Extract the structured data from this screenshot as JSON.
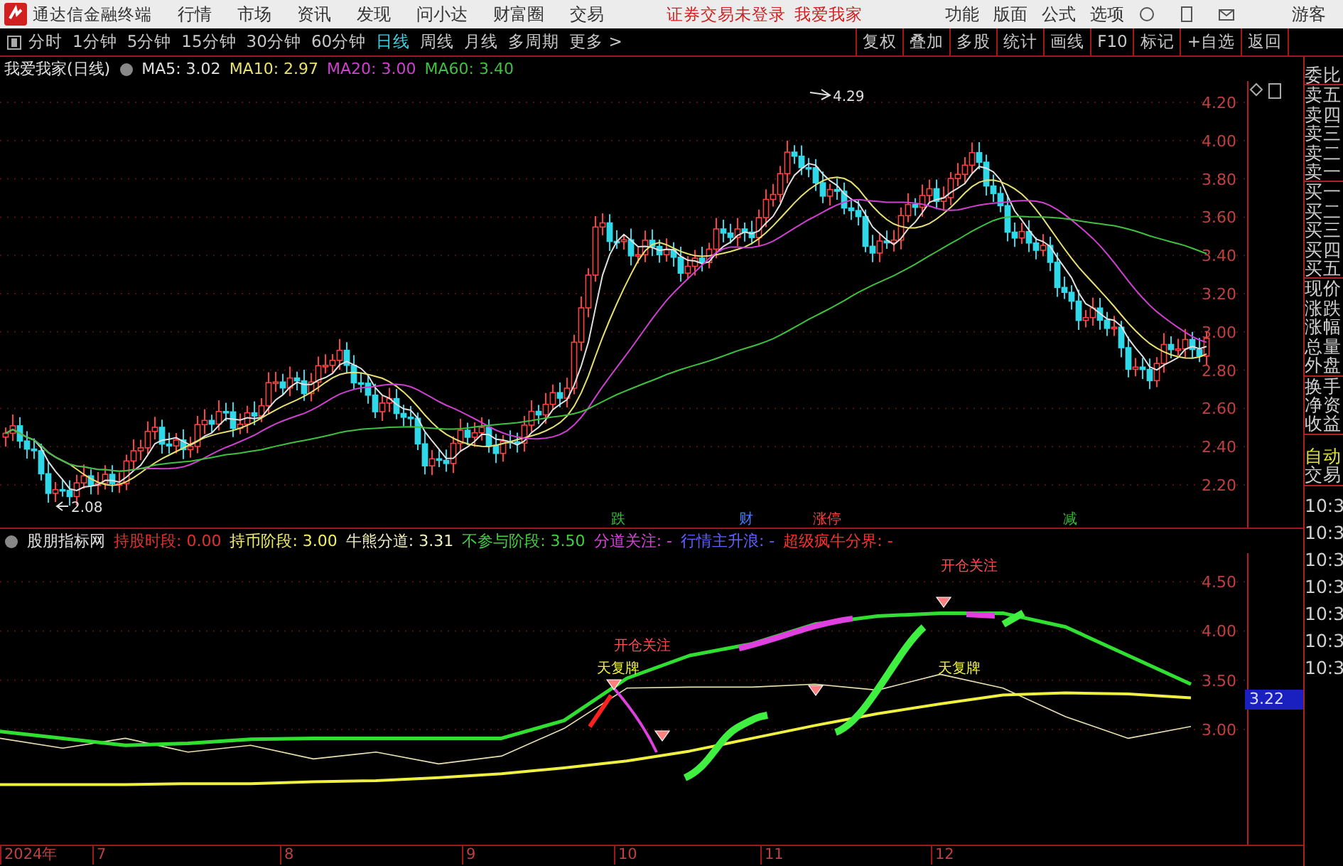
{
  "title_bar": {
    "app_name": "通达信金融终端",
    "menus": [
      "行情",
      "市场",
      "资讯",
      "发现",
      "问小达",
      "财富圈",
      "交易"
    ],
    "login_status": "证券交易未登录",
    "user_link": "我爱我家",
    "right_menus": [
      "功能",
      "版面",
      "公式",
      "选项"
    ],
    "user": "游客"
  },
  "toolbar": {
    "periods": [
      {
        "label": "分时",
        "selected": false
      },
      {
        "label": "1分钟",
        "selected": false
      },
      {
        "label": "5分钟",
        "selected": false
      },
      {
        "label": "15分钟",
        "selected": false
      },
      {
        "label": "30分钟",
        "selected": false
      },
      {
        "label": "60分钟",
        "selected": false
      },
      {
        "label": "日线",
        "selected": true
      },
      {
        "label": "周线",
        "selected": false
      },
      {
        "label": "月线",
        "selected": false
      },
      {
        "label": "多周期",
        "selected": false
      },
      {
        "label": "更多 >",
        "selected": false
      }
    ],
    "buttons": [
      "复权",
      "叠加",
      "多股",
      "统计",
      "画线",
      "F10",
      "标记",
      "+自选",
      "返回"
    ]
  },
  "price_chart": {
    "title": "我爱我家(日线)",
    "ma": [
      {
        "text": "MA5: 3.02",
        "color": "#e0e0e0"
      },
      {
        "text": "MA10: 2.97",
        "color": "#e8e070"
      },
      {
        "text": "MA20: 3.00",
        "color": "#d040d0"
      },
      {
        "text": "MA60: 3.40",
        "color": "#40c040"
      }
    ],
    "high_label": "4.29",
    "low_label": "2.08",
    "yticks": [
      "4.20",
      "4.00",
      "3.80",
      "3.60",
      "3.40",
      "3.20",
      "3.00",
      "2.80",
      "2.60",
      "2.40",
      "2.20"
    ],
    "markers": [
      {
        "text": "跌",
        "color": "#30c030"
      },
      {
        "text": "财",
        "color": "#4080ff"
      },
      {
        "text": "涨停",
        "color": "#ff4040"
      },
      {
        "text": "减",
        "color": "#30c030"
      }
    ]
  },
  "indicator": {
    "title": "股朋指标网",
    "legend": [
      {
        "text": "持股时段: 0.00",
        "color": "#e03030"
      },
      {
        "text": "持币阶段: 3.00",
        "color": "#f0f060"
      },
      {
        "text": "牛熊分道: 3.31",
        "color": "#f0f0c0"
      },
      {
        "text": "不参与阶段: 3.50",
        "color": "#40d040"
      },
      {
        "text": "分道关注: -",
        "color": "#e040e0"
      },
      {
        "text": "行情主升浪: -",
        "color": "#6060ff"
      },
      {
        "text": "超级疯牛分界: -",
        "color": "#ff3030"
      }
    ],
    "labels": [
      {
        "kind": "alert",
        "text": "开仓关注"
      },
      {
        "kind": "resume",
        "text": "天复牌"
      },
      {
        "kind": "alert",
        "text": "开仓关注"
      },
      {
        "kind": "resume",
        "text": "天复牌"
      }
    ],
    "current_value": "3.22",
    "chart_data": {
      "type": "line",
      "grid": true,
      "ylim": [
        1.83,
        4.79
      ],
      "yticks": [
        {
          "value": 4.5,
          "label": "4.50"
        },
        {
          "value": 4.0,
          "label": "4.00"
        },
        {
          "value": 3.5,
          "label": "3.50"
        },
        {
          "value": 3.0,
          "label": "3.00"
        }
      ],
      "series": [
        {
          "color": "#30e030",
          "values": [
            2.98,
            2.91,
            2.84,
            2.86,
            2.9,
            2.91,
            2.91,
            2.91,
            2.91,
            3.09,
            3.52,
            3.75,
            3.87,
            4.07,
            4.15,
            4.18,
            4.18,
            4.04,
            3.75,
            3.46
          ]
        },
        {
          "color": "#f0f040",
          "values": [
            2.44,
            2.44,
            2.44,
            2.45,
            2.45,
            2.47,
            2.48,
            2.51,
            2.55,
            2.61,
            2.68,
            2.78,
            2.91,
            3.04,
            3.16,
            3.26,
            3.35,
            3.37,
            3.36,
            3.32
          ]
        },
        {
          "color": "#e8e0b0",
          "values": [
            2.91,
            2.81,
            2.91,
            2.77,
            2.84,
            2.7,
            2.77,
            2.65,
            2.73,
            3.01,
            3.42,
            3.43,
            3.43,
            3.46,
            3.4,
            3.56,
            3.42,
            3.13,
            2.91,
            3.03
          ]
        }
      ]
    }
  },
  "x_axis": [
    "2024年",
    "7",
    "8",
    "9",
    "10",
    "11",
    "12"
  ],
  "quote_panel": {
    "groups": [
      [
        "委比"
      ],
      [
        "卖五",
        "卖四",
        "卖三",
        "卖二",
        "卖一"
      ],
      [
        "买一",
        "买二",
        "买三",
        "买四",
        "买五"
      ],
      [
        "现价",
        "涨跌",
        "涨幅",
        "总量",
        "外盘"
      ],
      [
        "换手",
        "净资",
        "收益"
      ]
    ],
    "auto": "自动",
    "trade": "交易",
    "times": [
      "10:3",
      "10:3",
      "10:3",
      "10:3",
      "10:3",
      "10:3",
      "10:3"
    ]
  }
}
